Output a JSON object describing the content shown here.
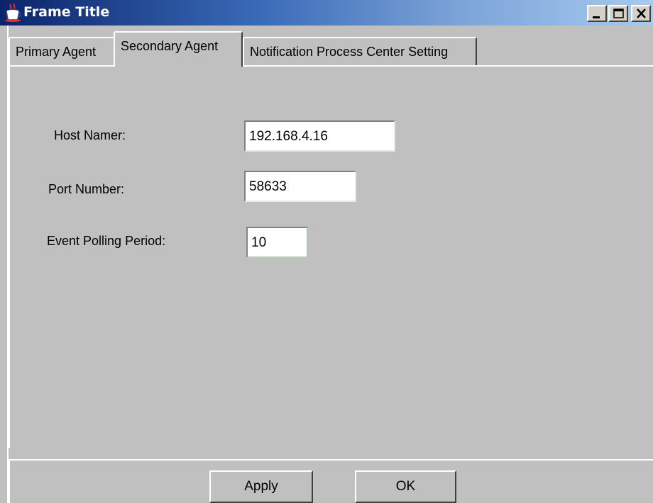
{
  "window": {
    "title": "Frame Title",
    "controls": [
      "minimize",
      "maximize",
      "close"
    ]
  },
  "tabs": [
    {
      "label": "Primary Agent",
      "active": false
    },
    {
      "label": "Secondary Agent",
      "active": true
    },
    {
      "label": "Notification Process Center Setting",
      "active": false
    }
  ],
  "form": {
    "host_label": "Host Namer:",
    "host_value": "192.168.4.16",
    "port_label": "Port Number:",
    "port_value": "58633",
    "polling_label": "Event Polling Period:",
    "polling_value": "10"
  },
  "buttons": {
    "apply": "Apply",
    "ok": "OK"
  },
  "icons": {
    "app": "java-coffee-cup-icon",
    "minimize": "minimize-icon",
    "maximize": "maximize-icon",
    "close": "close-icon"
  },
  "colors": {
    "title_bar_start": "#0a246a",
    "title_bar_end": "#a6caf0",
    "face": "#c0c0c0"
  }
}
